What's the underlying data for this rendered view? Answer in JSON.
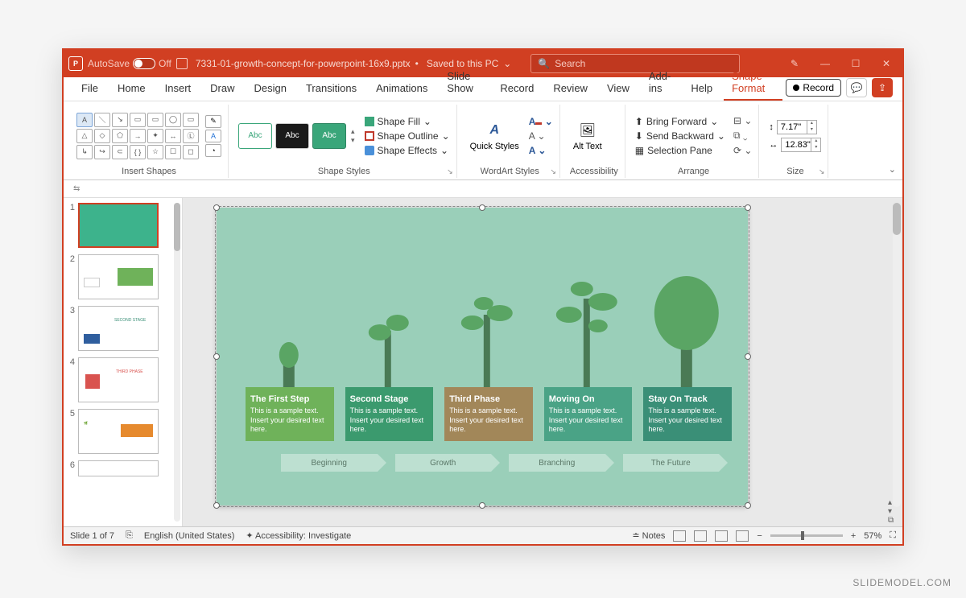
{
  "titlebar": {
    "autosave_label": "AutoSave",
    "autosave_state": "Off",
    "filename": "7331-01-growth-concept-for-powerpoint-16x9.pptx",
    "saved_status": "Saved to this PC",
    "search_placeholder": "Search"
  },
  "ribbon_tabs": [
    "File",
    "Home",
    "Insert",
    "Draw",
    "Design",
    "Transitions",
    "Animations",
    "Slide Show",
    "Record",
    "Review",
    "View",
    "Add-ins",
    "Help",
    "Shape Format"
  ],
  "ribbon_active_tab": "Shape Format",
  "ribbon_right": {
    "record": "Record"
  },
  "ribbon": {
    "insert_shapes_label": "Insert Shapes",
    "shape_styles_label": "Shape Styles",
    "shape_fill": "Shape Fill",
    "shape_outline": "Shape Outline",
    "shape_effects": "Shape Effects",
    "wordart_label": "WordArt Styles",
    "quick_styles": "Quick Styles",
    "accessibility_label": "Accessibility",
    "alt_text": "Alt Text",
    "arrange_label": "Arrange",
    "bring_forward": "Bring Forward",
    "send_backward": "Send Backward",
    "selection_pane": "Selection Pane",
    "size_label": "Size",
    "height": "7.17\"",
    "width": "12.83\"",
    "sample_abc": "Abc"
  },
  "thumbnails": {
    "count": 7,
    "selected": 1,
    "visible_numbers": [
      "1",
      "2",
      "3",
      "4",
      "5",
      "6"
    ]
  },
  "slide": {
    "stages": [
      {
        "title": "The First Step",
        "body": "This is a sample text. Insert your desired text here.",
        "color": "#6fb25a"
      },
      {
        "title": "Second Stage",
        "body": "This is a sample text. Insert your desired text here.",
        "color": "#3b9a6e"
      },
      {
        "title": "Third Phase",
        "body": "This is a sample text. Insert your desired text here.",
        "color": "#a28759"
      },
      {
        "title": "Moving On",
        "body": "This is a sample text. Insert your desired text here.",
        "color": "#4aa386"
      },
      {
        "title": "Stay On Track",
        "body": "This is a sample text. Insert your desired text here.",
        "color": "#3a8f77"
      }
    ],
    "arrows": [
      "Beginning",
      "Growth",
      "Branching",
      "The Future"
    ]
  },
  "statusbar": {
    "slide_indicator": "Slide 1 of 7",
    "language": "English (United States)",
    "accessibility": "Accessibility: Investigate",
    "notes": "Notes",
    "zoom": "57%"
  },
  "watermark": "SLIDEMODEL.COM"
}
